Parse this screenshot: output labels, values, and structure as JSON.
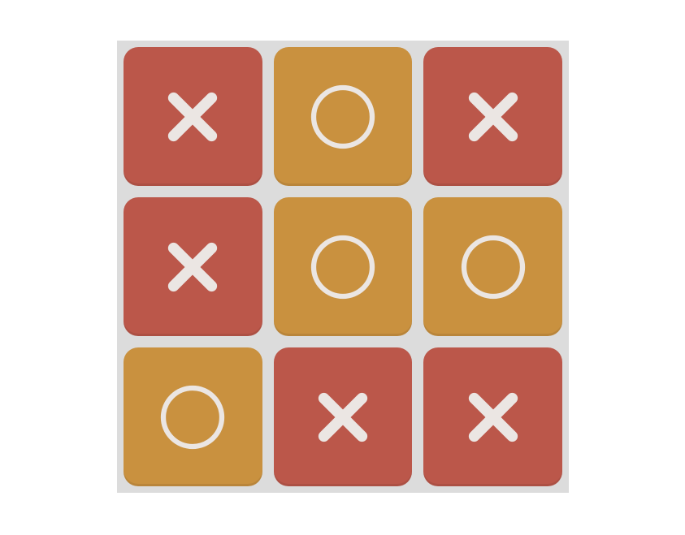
{
  "game": {
    "title": "",
    "colors": {
      "board": "#dcdcdc",
      "x_tile": "#bb574a",
      "o_tile": "#c9913f",
      "mark": "#ebe6e3"
    },
    "cells": [
      {
        "mark": "X",
        "icon": "x-icon"
      },
      {
        "mark": "O",
        "icon": "o-icon"
      },
      {
        "mark": "X",
        "icon": "x-icon"
      },
      {
        "mark": "X",
        "icon": "x-icon"
      },
      {
        "mark": "O",
        "icon": "o-icon"
      },
      {
        "mark": "O",
        "icon": "o-icon"
      },
      {
        "mark": "O",
        "icon": "o-icon"
      },
      {
        "mark": "X",
        "icon": "x-icon"
      },
      {
        "mark": "X",
        "icon": "x-icon"
      }
    ]
  }
}
